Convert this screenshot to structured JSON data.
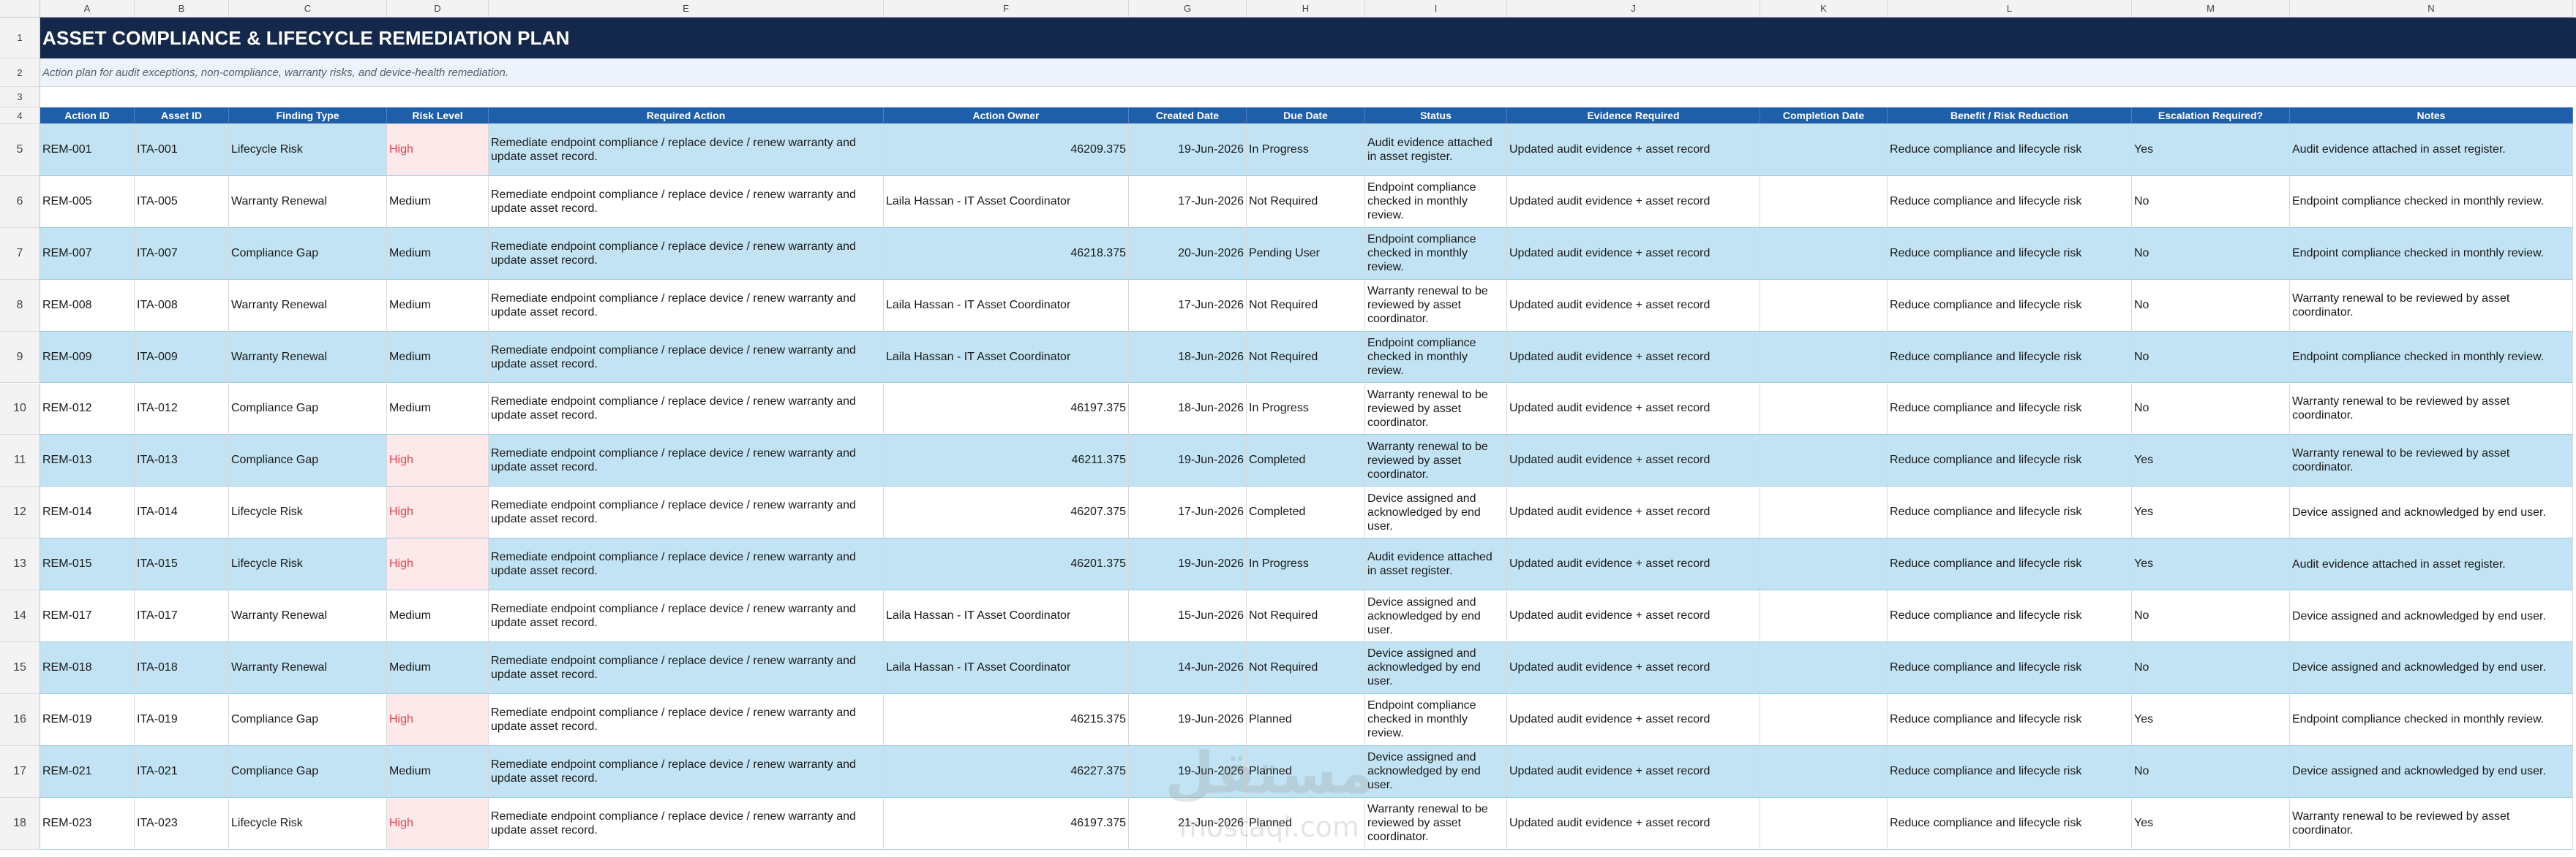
{
  "column_letters": [
    "A",
    "B",
    "C",
    "D",
    "E",
    "F",
    "G",
    "H",
    "I",
    "J",
    "K",
    "L",
    "M",
    "N"
  ],
  "row_numbers": [
    "1",
    "2",
    "3",
    "4",
    "5",
    "6",
    "7",
    "8",
    "9",
    "10",
    "11",
    "12",
    "13",
    "14",
    "15",
    "16",
    "17",
    "18"
  ],
  "title": "ASSET COMPLIANCE & LIFECYCLE REMEDIATION PLAN",
  "subtitle": "Action plan for audit exceptions, non-compliance, warranty risks, and device-health remediation.",
  "headers": [
    "Action ID",
    "Asset ID",
    "Finding Type",
    "Risk Level",
    "Required Action",
    "Action Owner",
    "Created Date",
    "Due Date",
    "Status",
    "Evidence Required",
    "Completion Date",
    "Benefit / Risk Reduction",
    "Escalation Required?",
    "Notes"
  ],
  "rows": [
    {
      "a": "REM-001",
      "b": "ITA-001",
      "c": "Lifecycle Risk",
      "d": "High",
      "e": "Remediate endpoint compliance / replace device / renew warranty and update asset record.",
      "f": "46209.375",
      "g": "19-Jun-2026",
      "h": "In Progress",
      "i": "Audit evidence attached in asset register.",
      "j": "Updated audit evidence + asset record",
      "k": "",
      "l": "Reduce compliance and lifecycle risk",
      "m": "Yes",
      "n": "Audit evidence attached in asset register."
    },
    {
      "a": "REM-005",
      "b": "ITA-005",
      "c": "Warranty Renewal",
      "d": "Medium",
      "e": "Remediate endpoint compliance / replace device / renew warranty and update asset record.",
      "f": "Laila Hassan - IT Asset Coordinator",
      "g": "17-Jun-2026",
      "h": "Not Required",
      "i": "Endpoint compliance checked in monthly review.",
      "j": "Updated audit evidence + asset record",
      "k": "",
      "l": "Reduce compliance and lifecycle risk",
      "m": "No",
      "n": "Endpoint compliance checked in monthly review."
    },
    {
      "a": "REM-007",
      "b": "ITA-007",
      "c": "Compliance Gap",
      "d": "Medium",
      "e": "Remediate endpoint compliance / replace device / renew warranty and update asset record.",
      "f": "46218.375",
      "g": "20-Jun-2026",
      "h": "Pending User",
      "i": "Endpoint compliance checked in monthly review.",
      "j": "Updated audit evidence + asset record",
      "k": "",
      "l": "Reduce compliance and lifecycle risk",
      "m": "No",
      "n": "Endpoint compliance checked in monthly review."
    },
    {
      "a": "REM-008",
      "b": "ITA-008",
      "c": "Warranty Renewal",
      "d": "Medium",
      "e": "Remediate endpoint compliance / replace device / renew warranty and update asset record.",
      "f": "Laila Hassan - IT Asset Coordinator",
      "g": "17-Jun-2026",
      "h": "Not Required",
      "i": "Warranty renewal to be reviewed by asset coordinator.",
      "j": "Updated audit evidence + asset record",
      "k": "",
      "l": "Reduce compliance and lifecycle risk",
      "m": "No",
      "n": "Warranty renewal to be reviewed by asset coordinator."
    },
    {
      "a": "REM-009",
      "b": "ITA-009",
      "c": "Warranty Renewal",
      "d": "Medium",
      "e": "Remediate endpoint compliance / replace device / renew warranty and update asset record.",
      "f": "Laila Hassan - IT Asset Coordinator",
      "g": "18-Jun-2026",
      "h": "Not Required",
      "i": "Endpoint compliance checked in monthly review.",
      "j": "Updated audit evidence + asset record",
      "k": "",
      "l": "Reduce compliance and lifecycle risk",
      "m": "No",
      "n": "Endpoint compliance checked in monthly review."
    },
    {
      "a": "REM-012",
      "b": "ITA-012",
      "c": "Compliance Gap",
      "d": "Medium",
      "e": "Remediate endpoint compliance / replace device / renew warranty and update asset record.",
      "f": "46197.375",
      "g": "18-Jun-2026",
      "h": "In Progress",
      "i": "Warranty renewal to be reviewed by asset coordinator.",
      "j": "Updated audit evidence + asset record",
      "k": "",
      "l": "Reduce compliance and lifecycle risk",
      "m": "No",
      "n": "Warranty renewal to be reviewed by asset coordinator."
    },
    {
      "a": "REM-013",
      "b": "ITA-013",
      "c": "Compliance Gap",
      "d": "High",
      "e": "Remediate endpoint compliance / replace device / renew warranty and update asset record.",
      "f": "46211.375",
      "g": "19-Jun-2026",
      "h": "Completed",
      "i": "Warranty renewal to be reviewed by asset coordinator.",
      "j": "Updated audit evidence + asset record",
      "k": "",
      "l": "Reduce compliance and lifecycle risk",
      "m": "Yes",
      "n": "Warranty renewal to be reviewed by asset coordinator."
    },
    {
      "a": "REM-014",
      "b": "ITA-014",
      "c": "Lifecycle Risk",
      "d": "High",
      "e": "Remediate endpoint compliance / replace device / renew warranty and update asset record.",
      "f": "46207.375",
      "g": "17-Jun-2026",
      "h": "Completed",
      "i": "Device assigned and acknowledged by end user.",
      "j": "Updated audit evidence + asset record",
      "k": "",
      "l": "Reduce compliance and lifecycle risk",
      "m": "Yes",
      "n": "Device assigned and acknowledged by end user."
    },
    {
      "a": "REM-015",
      "b": "ITA-015",
      "c": "Lifecycle Risk",
      "d": "High",
      "e": "Remediate endpoint compliance / replace device / renew warranty and update asset record.",
      "f": "46201.375",
      "g": "19-Jun-2026",
      "h": "In Progress",
      "i": "Audit evidence attached in asset register.",
      "j": "Updated audit evidence + asset record",
      "k": "",
      "l": "Reduce compliance and lifecycle risk",
      "m": "Yes",
      "n": "Audit evidence attached in asset register."
    },
    {
      "a": "REM-017",
      "b": "ITA-017",
      "c": "Warranty Renewal",
      "d": "Medium",
      "e": "Remediate endpoint compliance / replace device / renew warranty and update asset record.",
      "f": "Laila Hassan - IT Asset Coordinator",
      "g": "15-Jun-2026",
      "h": "Not Required",
      "i": "Device assigned and acknowledged by end user.",
      "j": "Updated audit evidence + asset record",
      "k": "",
      "l": "Reduce compliance and lifecycle risk",
      "m": "No",
      "n": "Device assigned and acknowledged by end user."
    },
    {
      "a": "REM-018",
      "b": "ITA-018",
      "c": "Warranty Renewal",
      "d": "Medium",
      "e": "Remediate endpoint compliance / replace device / renew warranty and update asset record.",
      "f": "Laila Hassan - IT Asset Coordinator",
      "g": "14-Jun-2026",
      "h": "Not Required",
      "i": "Device assigned and acknowledged by end user.",
      "j": "Updated audit evidence + asset record",
      "k": "",
      "l": "Reduce compliance and lifecycle risk",
      "m": "No",
      "n": "Device assigned and acknowledged by end user."
    },
    {
      "a": "REM-019",
      "b": "ITA-019",
      "c": "Compliance Gap",
      "d": "High",
      "e": "Remediate endpoint compliance / replace device / renew warranty and update asset record.",
      "f": "46215.375",
      "g": "19-Jun-2026",
      "h": "Planned",
      "i": "Endpoint compliance checked in monthly review.",
      "j": "Updated audit evidence + asset record",
      "k": "",
      "l": "Reduce compliance and lifecycle risk",
      "m": "Yes",
      "n": "Endpoint compliance checked in monthly review."
    },
    {
      "a": "REM-021",
      "b": "ITA-021",
      "c": "Compliance Gap",
      "d": "Medium",
      "e": "Remediate endpoint compliance / replace device / renew warranty and update asset record.",
      "f": "46227.375",
      "g": "19-Jun-2026",
      "h": "Planned",
      "i": "Device assigned and acknowledged by end user.",
      "j": "Updated audit evidence + asset record",
      "k": "",
      "l": "Reduce compliance and lifecycle risk",
      "m": "No",
      "n": "Device assigned and acknowledged by end user."
    },
    {
      "a": "REM-023",
      "b": "ITA-023",
      "c": "Lifecycle Risk",
      "d": "High",
      "e": "Remediate endpoint compliance / replace device / renew warranty and update asset record.",
      "f": "46197.375",
      "g": "21-Jun-2026",
      "h": "Planned",
      "i": "Warranty renewal to be reviewed by asset coordinator.",
      "j": "Updated audit evidence + asset record",
      "k": "",
      "l": "Reduce compliance and lifecycle risk",
      "m": "Yes",
      "n": "Warranty renewal to be reviewed by asset coordinator."
    }
  ],
  "watermark": {
    "arabic": "مستقل",
    "latin": "mostaql.com"
  },
  "colors": {
    "title_bg": "#14284b",
    "header_bg": "#1f5ea8",
    "alt_row": "#c2e3f3",
    "high_text": "#e2434b"
  }
}
